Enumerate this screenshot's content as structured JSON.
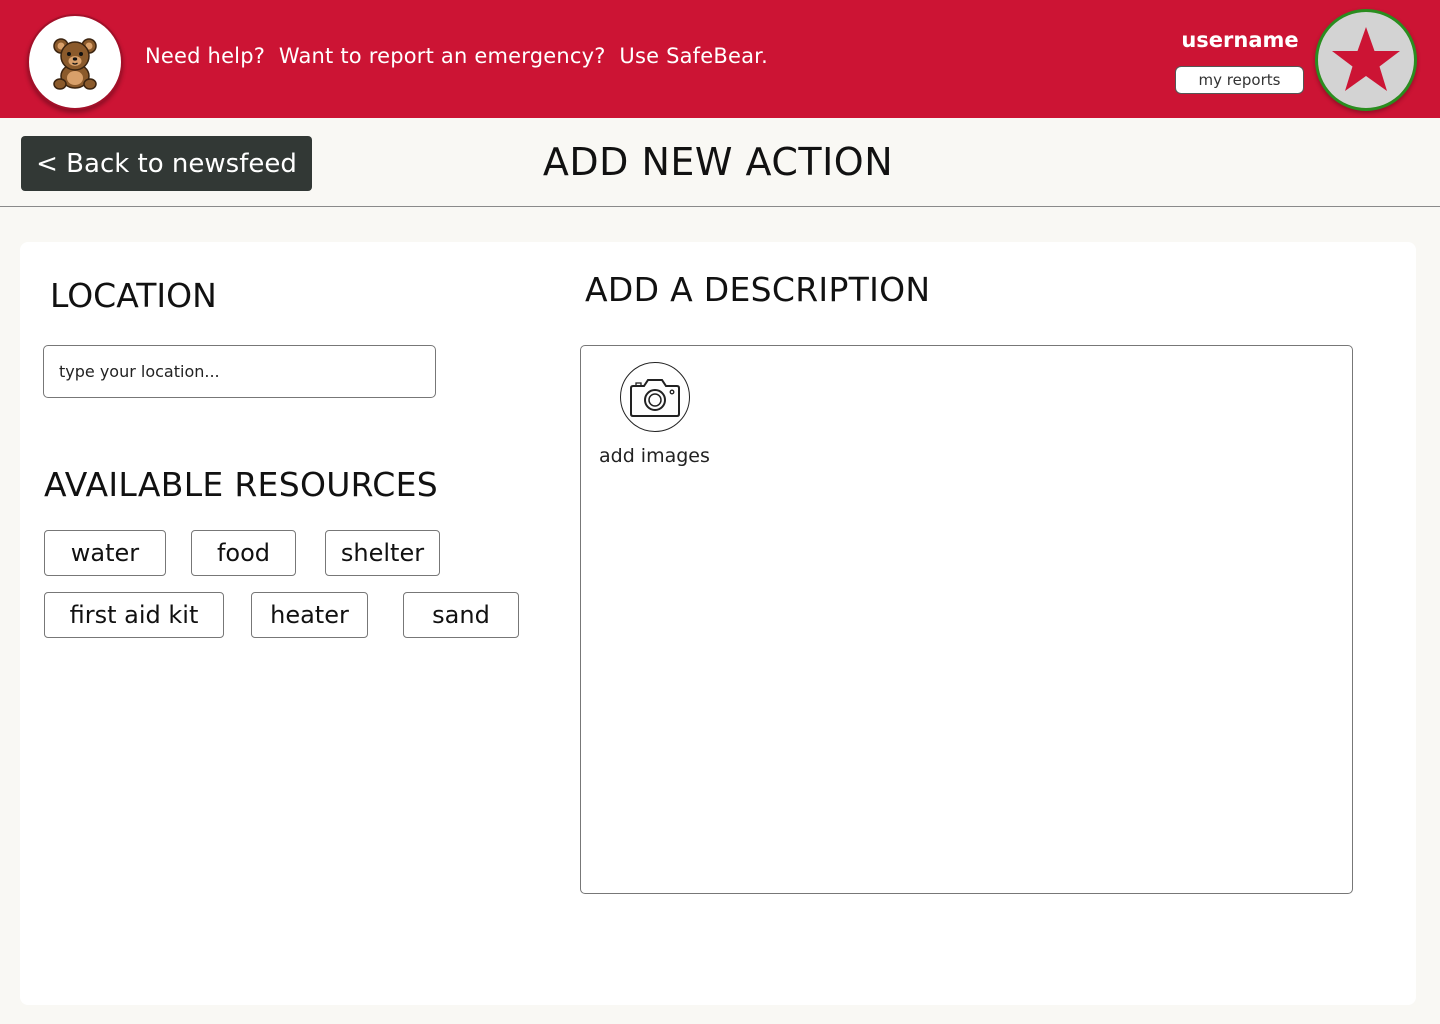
{
  "header": {
    "tagline": "Need help?  Want to report an emergency?  Use SafeBear.",
    "username": "username",
    "my_reports_label": "my reports",
    "brand_color": "#cc1434",
    "logo_icon": "teddy-bear-icon",
    "avatar_icon": "star-icon"
  },
  "nav": {
    "back_label": "< Back to newsfeed"
  },
  "page": {
    "title": "ADD NEW ACTION"
  },
  "location": {
    "heading": "LOCATION",
    "placeholder": "type your location..."
  },
  "resources": {
    "heading": "AVAILABLE RESOURCES",
    "items": [
      "water",
      "food",
      "shelter",
      "first aid kit",
      "heater",
      "sand"
    ]
  },
  "description": {
    "heading": "ADD A DESCRIPTION",
    "add_images_label": "add images",
    "camera_icon": "camera-icon"
  }
}
